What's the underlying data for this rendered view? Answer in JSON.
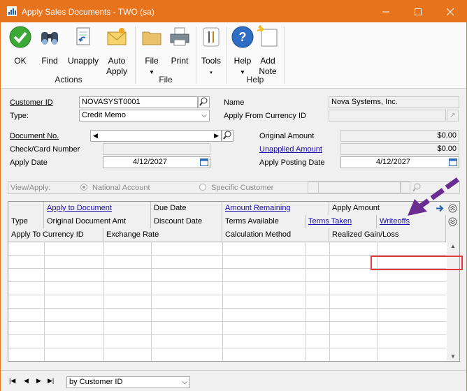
{
  "window": {
    "title": "Apply Sales Documents  -  TWO (sa)"
  },
  "ribbon": {
    "ok": "OK",
    "find": "Find",
    "unapply": "Unapply",
    "auto_apply_1": "Auto",
    "auto_apply_2": "Apply",
    "file": "File",
    "print": "Print",
    "tools": "Tools",
    "help": "Help",
    "add_note_1": "Add",
    "add_note_2": "Note",
    "groups": {
      "actions": "Actions",
      "file": "File",
      "help": "Help"
    }
  },
  "form": {
    "customer_id_label": "Customer ID",
    "customer_id": "NOVASYST0001",
    "type_label": "Type:",
    "type_value": "Credit Memo",
    "name_label": "Name",
    "name_value": "Nova Systems, Inc.",
    "apply_from_currency_label": "Apply From Currency ID",
    "apply_from_currency_value": "",
    "document_no_label": "Document No.",
    "document_no": "",
    "check_card_label": "Check/Card Number",
    "check_card": "",
    "apply_date_label": "Apply Date",
    "apply_date": "4/12/2027",
    "original_amount_label": "Original Amount",
    "original_amount": "$0.00",
    "unapplied_amount_label": "Unapplied Amount",
    "unapplied_amount": "$0.00",
    "apply_posting_date_label": "Apply Posting Date",
    "apply_posting_date": "4/12/2027",
    "view_apply_label": "View/Apply:",
    "national_account": "National Account",
    "specific_customer": "Specific Customer"
  },
  "grid": {
    "row1": [
      "",
      "Apply to Document",
      "Due Date",
      "Amount Remaining",
      "Apply Amount"
    ],
    "row2": [
      "Type",
      "Original Document Amt",
      "Discount Date",
      "Terms Available",
      "Terms Taken",
      "Writeoffs"
    ],
    "row3": [
      "Apply To Currency ID",
      "Exchange Rate",
      "Calculation Method",
      "Realized Gain/Loss"
    ]
  },
  "footer": {
    "sort_by": "by Customer ID"
  },
  "colors": {
    "titlebar": "#e8731d",
    "annotation_arrow": "#6a2c91",
    "annotation_box": "#e03a3a"
  }
}
